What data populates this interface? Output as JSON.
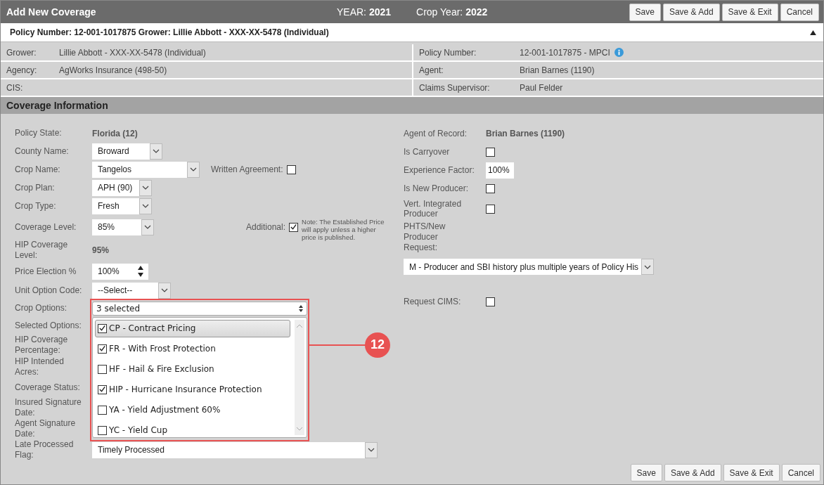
{
  "header": {
    "title": "Add New Coverage",
    "year_label": "YEAR:",
    "year": "2021",
    "crop_year_label": "Crop Year:",
    "crop_year": "2022",
    "buttons": [
      "Save",
      "Save & Add",
      "Save & Exit",
      "Cancel"
    ]
  },
  "policy_bar": {
    "text": "Policy Number: 12-001-1017875 Grower: Lillie Abbott - XXX-XX-5478 (Individual)",
    "expanded": true
  },
  "info_rows": [
    {
      "left_label": "Grower:",
      "left_value": "Lillie Abbott - XXX-XX-5478 (Individual)",
      "right_label": "Policy Number:",
      "right_value": "12-001-1017875 - MPCI",
      "info": true
    },
    {
      "left_label": "Agency:",
      "left_value": "AgWorks Insurance (498-50)",
      "right_label": "Agent:",
      "right_value": "Brian Barnes (1190)",
      "info": false
    },
    {
      "left_label": "CIS:",
      "right_label": "Claims Supervisor:",
      "right_value": "Paul Felder",
      "info": false
    }
  ],
  "section_title": "Coverage Information",
  "left_fields": [
    {
      "label": "Policy State:",
      "kind": "text",
      "value": "Florida (12)"
    },
    {
      "label": "County Name:",
      "kind": "select",
      "value": "Broward"
    },
    {
      "label": "Crop Name:",
      "kind": "select",
      "value": "Tangelos",
      "extra": {
        "label": "Written Agreement:",
        "checked": false
      }
    },
    {
      "label": "Crop Plan:",
      "kind": "select",
      "value": "APH (90)"
    },
    {
      "label": "Crop Type:",
      "kind": "select",
      "value": "Fresh"
    },
    {
      "label": "Coverage Level:",
      "kind": "select",
      "value": "85%",
      "extra": {
        "label": "Additional:",
        "checked": true,
        "note": "Note: The Established Price will apply unless a higher price is published."
      }
    },
    {
      "label": "HIP Coverage Level:",
      "kind": "text",
      "value": "95%"
    },
    {
      "label": "Price Election %",
      "kind": "spinner",
      "value": "100%"
    },
    {
      "label": "Unit Option Code:",
      "kind": "select",
      "value": "--Select--"
    },
    {
      "label": "Crop Options:",
      "kind": "multiselect",
      "value": "3 selected"
    },
    {
      "label": "Selected Options:",
      "kind": "hidden"
    },
    {
      "label": "HIP Coverage Percentage:",
      "kind": "hidden"
    },
    {
      "label": "HIP Intended Acres:",
      "kind": "hidden"
    },
    {
      "label": "Coverage Status:",
      "kind": "hidden"
    },
    {
      "label": "Insured Signature Date:",
      "kind": "hidden"
    },
    {
      "label": "Agent Signature Date:",
      "kind": "hidden"
    },
    {
      "label": "Late Processed Flag:",
      "kind": "select",
      "value": "Timely Processed"
    }
  ],
  "right_fields": [
    {
      "label": "Agent of Record:",
      "kind": "text",
      "value": "Brian Barnes (1190)"
    },
    {
      "label": "Is Carryover",
      "kind": "checkbox",
      "checked": false
    },
    {
      "label": "Experience Factor:",
      "kind": "input",
      "value": "100%"
    },
    {
      "label": "Is New Producer:",
      "kind": "checkbox",
      "checked": false
    },
    {
      "label": "Vert. Integrated Producer",
      "kind": "checkbox",
      "checked": false
    },
    {
      "label": "PHTS/New Producer Request:",
      "kind": "wideselect",
      "value": "M - Producer and SBI history plus multiple years of Policy His"
    },
    {
      "label": "Request CIMS:",
      "kind": "checkbox",
      "checked": false
    }
  ],
  "crop_options": [
    {
      "label": "CP - Contract Pricing",
      "checked": true,
      "selected": true
    },
    {
      "label": "FR - With Frost Protection",
      "checked": true,
      "selected": false
    },
    {
      "label": "HF - Hail & Fire Exclusion",
      "checked": false,
      "selected": false
    },
    {
      "label": "HIP - Hurricane Insurance Protection",
      "checked": true,
      "selected": false
    },
    {
      "label": "YA - Yield Adjustment 60%",
      "checked": false,
      "selected": false
    },
    {
      "label": "YC - Yield Cup",
      "checked": false,
      "selected": false
    }
  ],
  "callout": "12",
  "footer_buttons": [
    "Save",
    "Save & Add",
    "Save & Exit",
    "Cancel"
  ]
}
